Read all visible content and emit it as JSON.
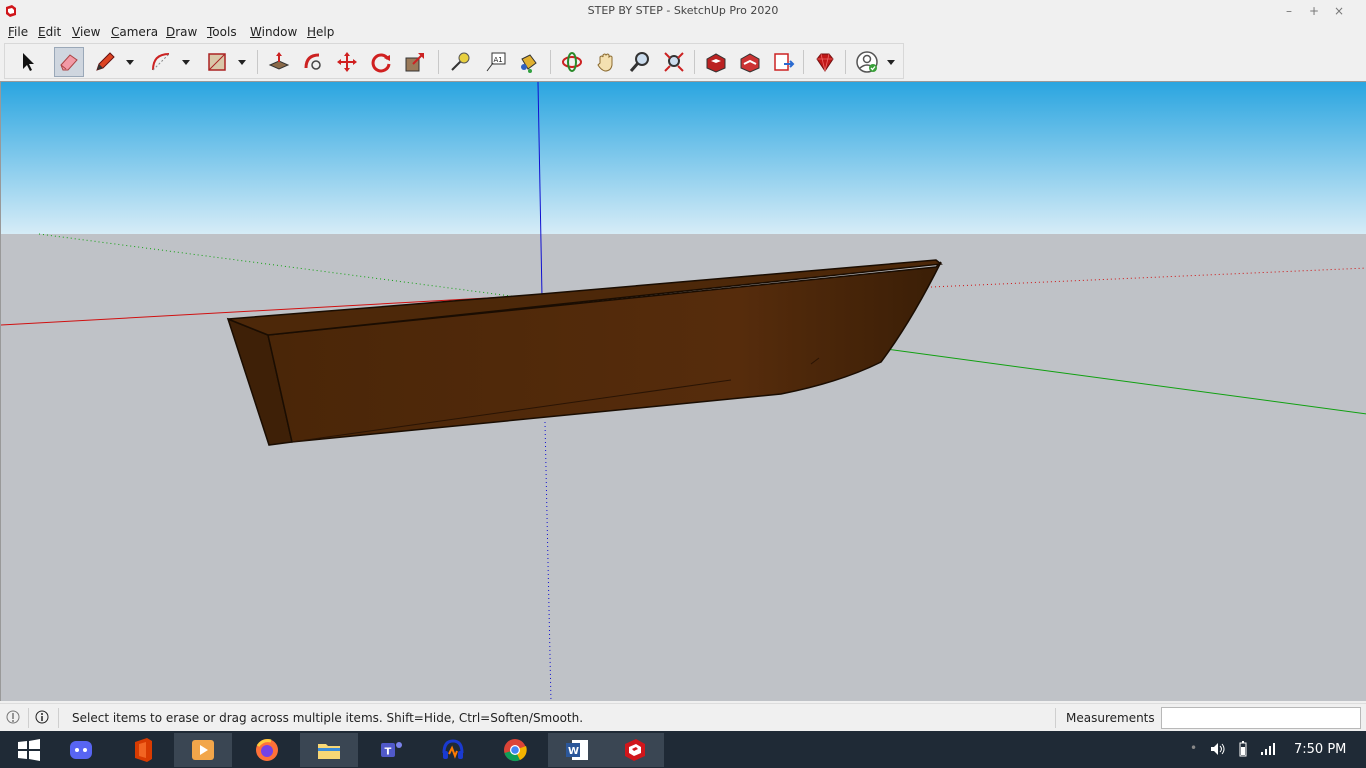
{
  "window": {
    "title": "STEP BY STEP - SketchUp Pro 2020",
    "minimize_glyph": "–",
    "maximize_glyph": "+",
    "close_glyph": "×"
  },
  "menu": {
    "items": [
      {
        "label": "File",
        "ul": "F",
        "rest": "ile"
      },
      {
        "label": "Edit",
        "ul": "E",
        "rest": "dit"
      },
      {
        "label": "View",
        "ul": "V",
        "rest": "iew"
      },
      {
        "label": "Camera",
        "ul": "C",
        "rest": "amera"
      },
      {
        "label": "Draw",
        "ul": "D",
        "rest": "raw"
      },
      {
        "label": "Tools",
        "ul": "T",
        "rest": "ools"
      },
      {
        "label": "Window",
        "ul": "W",
        "rest": "indow"
      },
      {
        "label": "Help",
        "ul": "H",
        "rest": "elp"
      }
    ]
  },
  "toolbar": {
    "active_tool": "eraser",
    "tools": [
      "select",
      "eraser",
      "pencil",
      "arc",
      "rectangle",
      "push-pull",
      "follow-me",
      "move",
      "rotate",
      "scale",
      "tape-measure",
      "text",
      "paint-bucket",
      "orbit",
      "pan",
      "zoom",
      "zoom-extents",
      "3d-warehouse",
      "extension-warehouse",
      "layout",
      "ruby-console",
      "account"
    ]
  },
  "viewport": {
    "sky_top": "#2aa5e0",
    "sky_bottom": "#d6ecf7",
    "ground": "#bfc2c7",
    "axis_red": "#d01010",
    "axis_green": "#10a010",
    "axis_blue": "#1010d0",
    "boat_color": "#4a2608"
  },
  "status": {
    "hint": "Select items to erase or drag across multiple items. Shift=Hide, Ctrl=Soften/Smooth.",
    "measurements_label": "Measurements",
    "measurements_value": ""
  },
  "taskbar": {
    "apps": [
      "windows-start",
      "discord",
      "office",
      "media-player",
      "firefox",
      "file-explorer",
      "teams",
      "audacity",
      "chrome",
      "word",
      "sketchup"
    ],
    "clock": "7:50 PM"
  }
}
